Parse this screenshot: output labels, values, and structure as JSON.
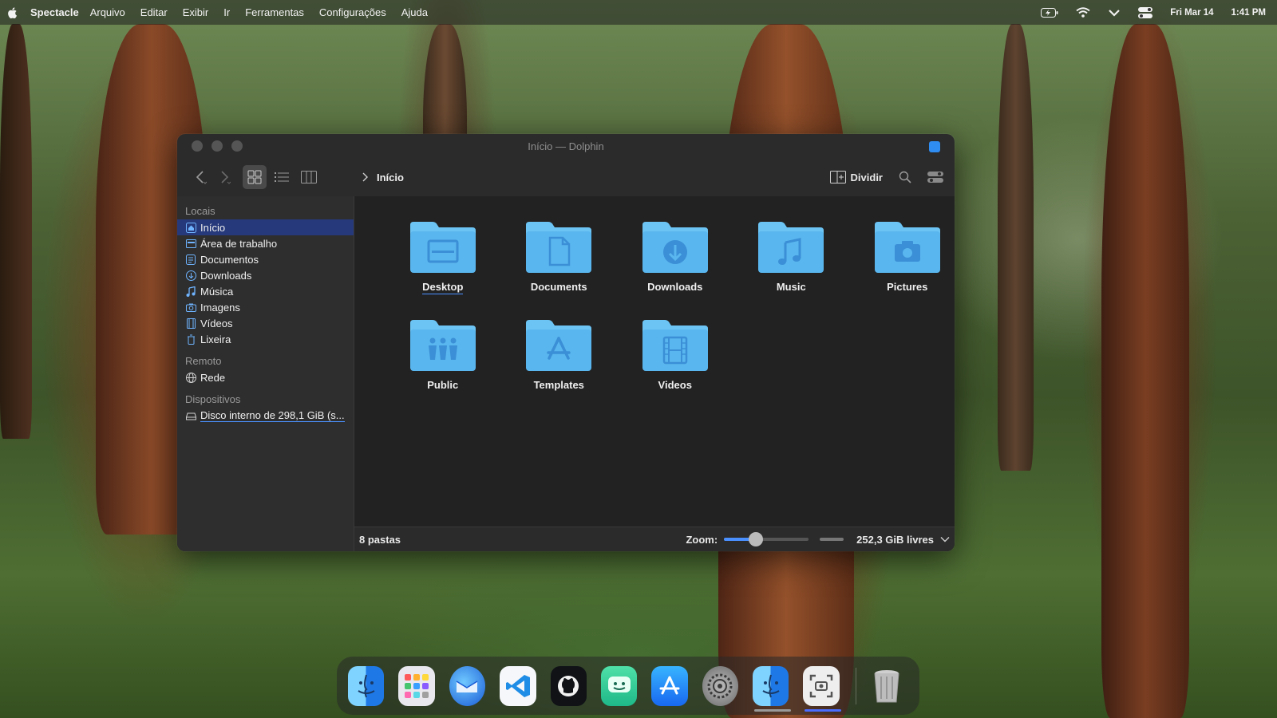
{
  "menubar": {
    "app_name": "Spectacle",
    "menus": [
      "Arquivo",
      "Editar",
      "Exibir",
      "Ir",
      "Ferramentas",
      "Configurações",
      "Ajuda"
    ],
    "date": "Fri Mar 14",
    "time": "1:41 PM",
    "status_icons": [
      "battery-icon",
      "wifi-icon",
      "chevron-down-icon",
      "control-center-icon"
    ]
  },
  "window": {
    "title": "Início — Dolphin",
    "breadcrumb": "Início",
    "split_label": "Dividir",
    "view_modes": [
      "icons-view",
      "details-view",
      "columns-view"
    ],
    "active_view": "icons-view"
  },
  "sidebar": {
    "sections": [
      {
        "title": "Locais",
        "items": [
          {
            "label": "Início",
            "icon": "home-icon",
            "selected": true
          },
          {
            "label": "Área de trabalho",
            "icon": "desktop-icon"
          },
          {
            "label": "Documentos",
            "icon": "document-icon"
          },
          {
            "label": "Downloads",
            "icon": "download-icon"
          },
          {
            "label": "Música",
            "icon": "music-icon"
          },
          {
            "label": "Imagens",
            "icon": "camera-icon"
          },
          {
            "label": "Vídeos",
            "icon": "film-icon"
          },
          {
            "label": "Lixeira",
            "icon": "trash-icon"
          }
        ]
      },
      {
        "title": "Remoto",
        "items": [
          {
            "label": "Rede",
            "icon": "network-icon"
          }
        ]
      },
      {
        "title": "Dispositivos",
        "items": [
          {
            "label": "Disco interno de 298,1 GiB (s...",
            "icon": "drive-icon"
          }
        ]
      }
    ]
  },
  "folders": [
    {
      "name": "Desktop",
      "glyph": "desktop"
    },
    {
      "name": "Documents",
      "glyph": "document"
    },
    {
      "name": "Downloads",
      "glyph": "download"
    },
    {
      "name": "Music",
      "glyph": "music"
    },
    {
      "name": "Pictures",
      "glyph": "camera"
    },
    {
      "name": "Public",
      "glyph": "people"
    },
    {
      "name": "Templates",
      "glyph": "appstore"
    },
    {
      "name": "Videos",
      "glyph": "film"
    }
  ],
  "status": {
    "count": "8 pastas",
    "zoom_label": "Zoom:",
    "zoom_level": 0.38,
    "free_space": "252,3 GiB livres"
  },
  "dock": {
    "apps": [
      {
        "name": "finder-icon",
        "running": false
      },
      {
        "name": "launchpad-icon",
        "running": false
      },
      {
        "name": "thunderbird-icon",
        "running": false
      },
      {
        "name": "vscode-icon",
        "running": false
      },
      {
        "name": "github-icon",
        "running": false
      },
      {
        "name": "chat-icon",
        "running": false
      },
      {
        "name": "appstore-icon",
        "running": false
      },
      {
        "name": "settings-icon",
        "running": false
      },
      {
        "name": "finder-icon",
        "running": true
      },
      {
        "name": "screenshot-icon",
        "running": true
      }
    ],
    "trash": "trash-icon"
  },
  "colors": {
    "accent": "#4a90ff",
    "folder_top": "#6cc4f4",
    "folder_body": "#5ab6ee",
    "folder_glyph": "#3a8fd6",
    "selection": "#26397a"
  }
}
